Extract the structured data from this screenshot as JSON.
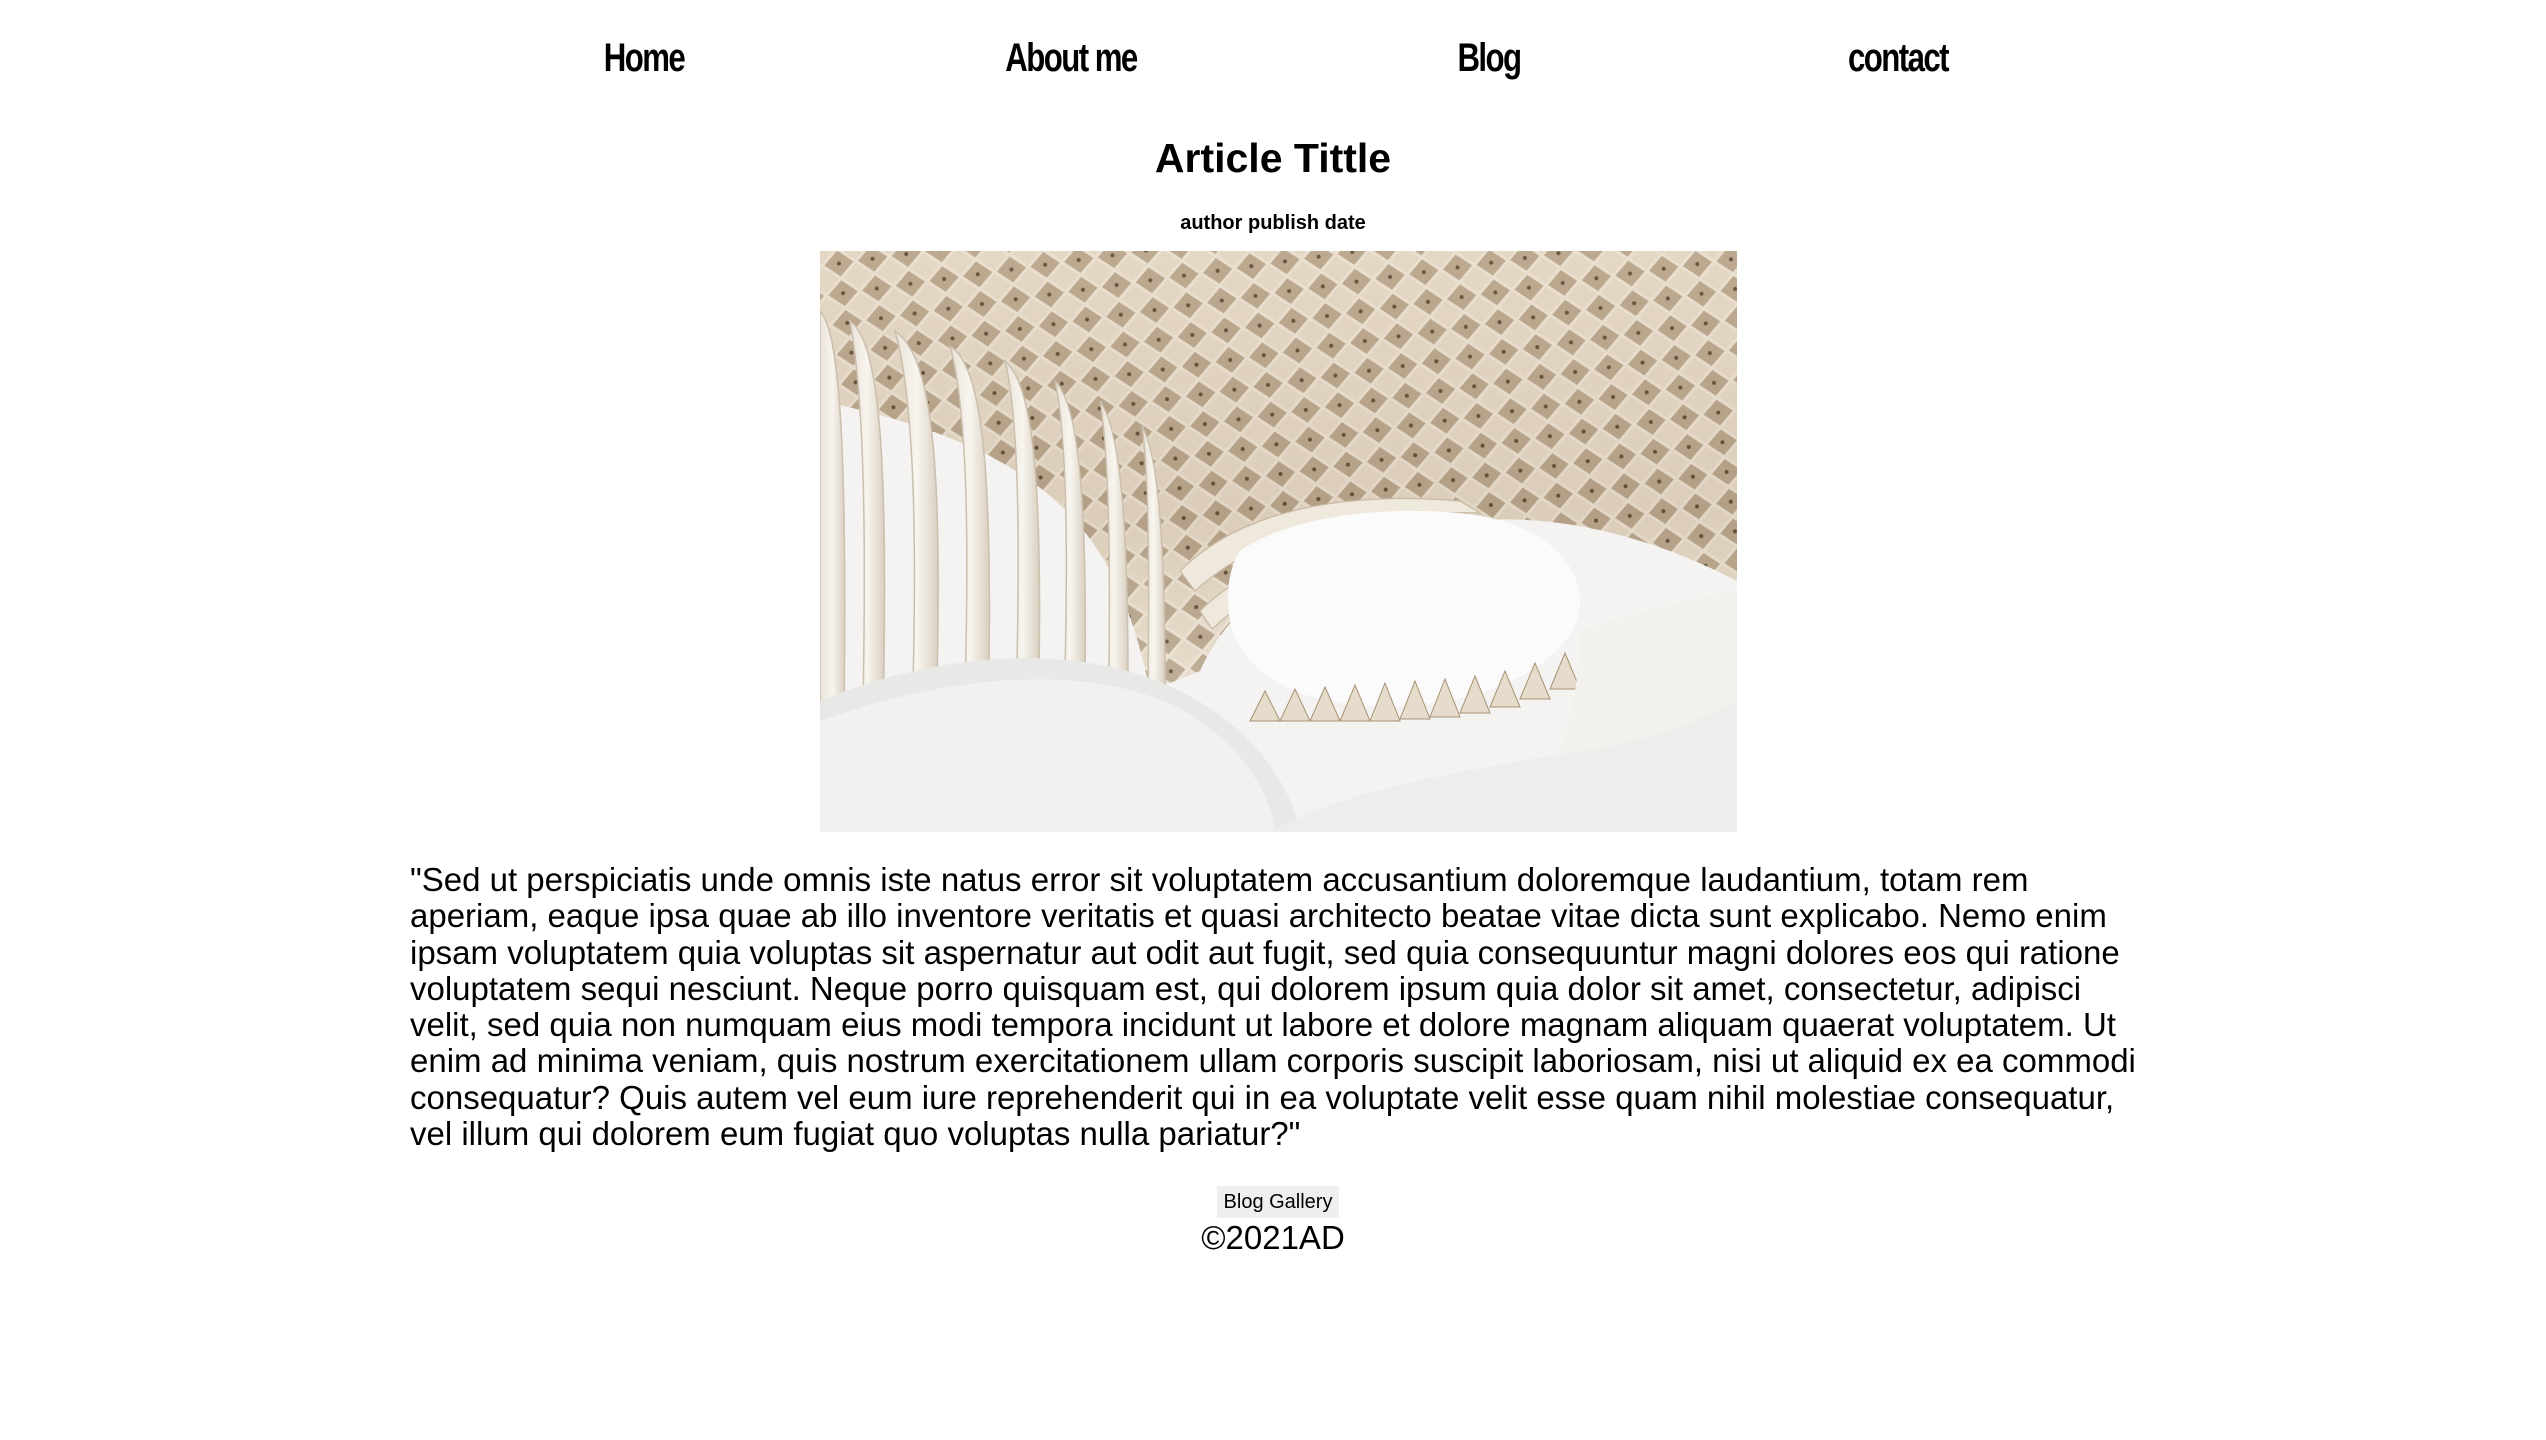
{
  "nav": {
    "items": [
      {
        "label": "Home"
      },
      {
        "label": "About me"
      },
      {
        "label": "Blog"
      },
      {
        "label": "contact"
      }
    ]
  },
  "article": {
    "title": "Article Tittle",
    "meta": "author publish date",
    "image_subject": "curved white wooden lattice canopy architecture",
    "body": "\"Sed ut perspiciatis unde omnis iste natus error sit voluptatem accusantium doloremque laudantium, totam rem aperiam, eaque ipsa quae ab illo inventore veritatis et quasi architecto beatae vitae dicta sunt explicabo. Nemo enim ipsam voluptatem quia voluptas sit aspernatur aut odit aut fugit, sed quia consequuntur magni dolores eos qui ratione voluptatem sequi nesciunt. Neque porro quisquam est, qui dolorem ipsum quia dolor sit amet, consectetur, adipisci velit, sed quia non numquam eius modi tempora incidunt ut labore et dolore magnam aliquam quaerat voluptatem. Ut enim ad minima veniam, quis nostrum exercitationem ullam corporis suscipit laboriosam, nisi ut aliquid ex ea commodi consequatur? Quis autem vel eum iure reprehenderit qui in ea voluptate velit esse quam nihil molestiae consequatur, vel illum qui dolorem eum fugiat quo voluptas nulla pariatur?\""
  },
  "footer": {
    "gallery_button": "Blog Gallery",
    "copyright": "©2021AD"
  },
  "colors": {
    "text": "#000000",
    "background": "#ffffff",
    "button_bg": "#efefef"
  }
}
